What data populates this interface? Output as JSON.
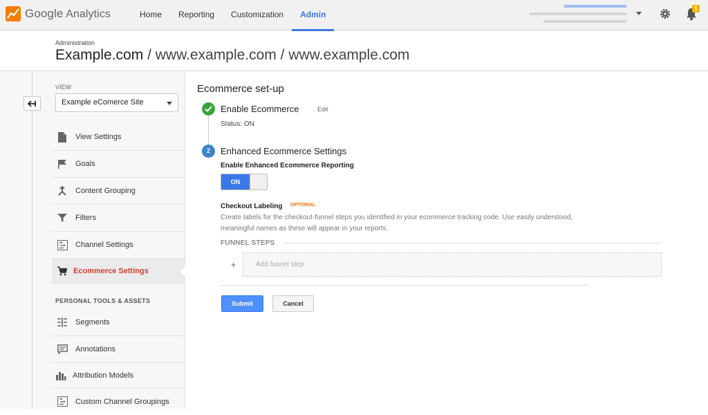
{
  "brand": {
    "google": "Google",
    "analytics": "Analytics"
  },
  "nav": [
    {
      "label": "Home"
    },
    {
      "label": "Reporting"
    },
    {
      "label": "Customization"
    },
    {
      "label": "Admin",
      "active": true
    }
  ],
  "header": {
    "section": "Administration",
    "account": "Example.com",
    "property": "www.example.com",
    "view": "www.example.com",
    "separator": "/"
  },
  "notifications": {
    "count": "1"
  },
  "sidebar": {
    "view_label": "VIEW",
    "view_selected": "Example eComerce Site",
    "items": [
      {
        "label": "View Settings",
        "icon": "document-icon"
      },
      {
        "label": "Goals",
        "icon": "flag-icon"
      },
      {
        "label": "Content Grouping",
        "icon": "grouping-icon"
      },
      {
        "label": "Filters",
        "icon": "filter-icon"
      },
      {
        "label": "Channel Settings",
        "icon": "channel-icon"
      },
      {
        "label": "Ecommerce Settings",
        "icon": "cart-icon",
        "active": true
      }
    ],
    "personal_label": "PERSONAL TOOLS & ASSETS",
    "personal_items": [
      {
        "label": "Segments",
        "icon": "segments-icon"
      },
      {
        "label": "Annotations",
        "icon": "annotation-icon"
      },
      {
        "label": "Attribution Models",
        "icon": "bar-chart-icon"
      },
      {
        "label": "Custom Channel Groupings",
        "icon": "channel-icon"
      }
    ]
  },
  "main": {
    "title": "Ecommerce set-up",
    "step1": {
      "title": "Enable Ecommerce",
      "edit": "Edit",
      "status": "Status: ON"
    },
    "step2": {
      "number": "2",
      "title": "Enhanced Ecommerce Settings",
      "toggle_label": "Enable Enhanced Ecommerce Reporting",
      "toggle_value": "ON"
    },
    "checkout": {
      "label": "Checkout Labeling",
      "optional": "OPTIONAL",
      "description": "Create labels for the checkout-funnel steps you identified in your ecommerce tracking code. Use easily understood, meaningful names as these will appear in your reports."
    },
    "funnel_label": "FUNNEL STEPS",
    "add_placeholder": "Add funnel step",
    "plus": "+",
    "submit": "Submit",
    "cancel": "Cancel"
  },
  "colors": {
    "accent": "#3b78e7",
    "active_item": "#d23f31",
    "success": "#3ca33c",
    "optional": "#e8710a"
  }
}
